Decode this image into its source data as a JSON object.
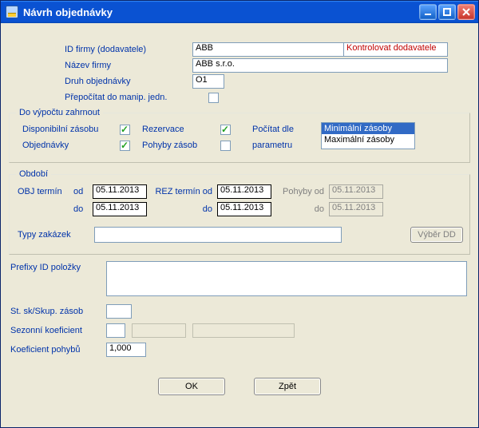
{
  "window": {
    "title": "Návrh objednávky"
  },
  "top": {
    "id_firmy_label": "ID firmy (dodavatele)",
    "id_firmy_value": "ABB",
    "kontrolovat_label": "Kontrolovat dodavatele",
    "nazev_firmy_label": "Název firmy",
    "nazev_firmy_value": "ABB s.r.o.",
    "druh_label": "Druh objednávky",
    "druh_value": "O1",
    "prepocitat_label": "Přepočítat do manip. jedn."
  },
  "zahrnout": {
    "legend": "Do výpočtu zahrnout",
    "disponibilni": "Disponibilní zásobu",
    "objednavky": "Objednávky",
    "rezervace": "Rezervace",
    "pohyby": "Pohyby zásob",
    "pocitat": "Počítat dle parametru",
    "options": {
      "min": "Minimální zásoby",
      "max": "Maximální zásoby"
    },
    "checks": {
      "disponibilni": true,
      "objednavky": true,
      "rezervace": true,
      "pohyby": false
    }
  },
  "obdobi": {
    "legend": "Období",
    "obj_termin": "OBJ termín",
    "od": "od",
    "do": "do",
    "rez_termin": "REZ termín od",
    "pohyby_od": "Pohyby od",
    "obj_od": "05.11.2013",
    "obj_do": "05.11.2013",
    "rez_od": "05.11.2013",
    "rez_do": "05.11.2013",
    "poh_od": "05.11.2013",
    "poh_do": "05.11.2013",
    "typy_zakazek_label": "Typy zakázek",
    "vyber_dd": "Výběr DD"
  },
  "lower": {
    "prefixy_label": "Prefixy ID položky",
    "stsk_label": "St. sk/Skup. zásob",
    "sezonni_label": "Sezonní koeficient",
    "koef_pohybu_label": "Koeficient pohybů",
    "koef_pohybu_value": "1,000"
  },
  "buttons": {
    "ok": "OK",
    "zpet": "Zpět"
  }
}
